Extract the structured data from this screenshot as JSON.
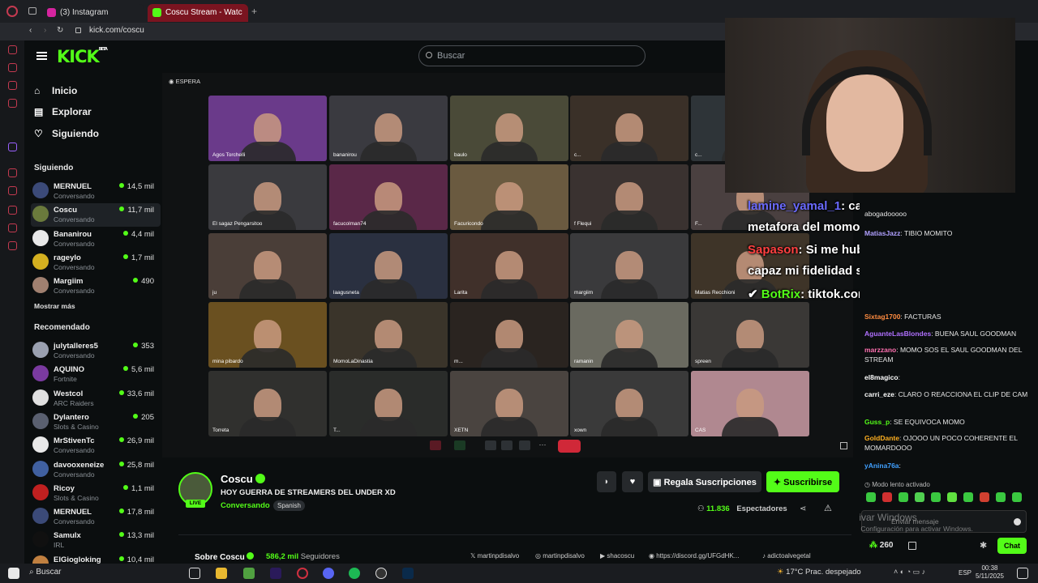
{
  "browser": {
    "tabs": [
      {
        "label": "(3) Instagram",
        "color": "#d6249f"
      },
      {
        "label": "Coscu Stream - Watc",
        "color": "#53fc18"
      }
    ],
    "url": "kick.com/coscu"
  },
  "header": {
    "logo": "KICK",
    "logo_badge": "BETA",
    "search_placeholder": "Buscar"
  },
  "nav": [
    {
      "label": "Inicio",
      "icon": "home-icon"
    },
    {
      "label": "Explorar",
      "icon": "compass-icon"
    },
    {
      "label": "Siguiendo",
      "icon": "heart-icon"
    }
  ],
  "following": {
    "title": "Siguiendo",
    "channels": [
      {
        "name": "MERNUEL",
        "sub": "Conversando",
        "viewers": "14,5 mil",
        "color": "#3b4a78"
      },
      {
        "name": "Coscu",
        "sub": "Conversando",
        "viewers": "11,7 mil",
        "color": "#6a7a3c"
      },
      {
        "name": "Bananirou",
        "sub": "Conversando",
        "viewers": "4,4 mil",
        "color": "#e8e8e8"
      },
      {
        "name": "rageylo",
        "sub": "Conversando",
        "viewers": "1,7 mil",
        "color": "#d4b020"
      },
      {
        "name": "Margiim",
        "sub": "Conversando",
        "viewers": "490",
        "color": "#a08070"
      }
    ],
    "more": "Mostrar más"
  },
  "recommended": {
    "title": "Recomendado",
    "channels": [
      {
        "name": "julytalleres5",
        "sub": "Conversando",
        "viewers": "353",
        "color": "#9aa0b0"
      },
      {
        "name": "AQUINO",
        "sub": "Fortnite",
        "viewers": "5,6 mil",
        "color": "#7a3aa0"
      },
      {
        "name": "Westcol",
        "sub": "ARC Raiders",
        "viewers": "33,6 mil",
        "color": "#e0e0e0"
      },
      {
        "name": "Dylantero",
        "sub": "Slots & Casino",
        "viewers": "205",
        "color": "#5a6070"
      },
      {
        "name": "MrStivenTc",
        "sub": "Conversando",
        "viewers": "26,9 mil",
        "color": "#e8e8e8"
      },
      {
        "name": "davooxeneize",
        "sub": "Conversando",
        "viewers": "25,8 mil",
        "color": "#4060a0"
      },
      {
        "name": "Ricoy",
        "sub": "Slots & Casino",
        "viewers": "1,1 mil",
        "color": "#c02020"
      },
      {
        "name": "MERNUEL",
        "sub": "Conversando",
        "viewers": "17,8 mil",
        "color": "#3b4a78"
      },
      {
        "name": "Samulx",
        "sub": "IRL",
        "viewers": "13,3 mil",
        "color": "#101010"
      },
      {
        "name": "ElGiogloking",
        "sub": "",
        "viewers": "10,4 mil",
        "color": "#c08040"
      }
    ]
  },
  "video": {
    "status": "ESPERA",
    "participants": [
      {
        "name": "Agos Torchelli",
        "color": "#6a3a8a"
      },
      {
        "name": "bananirou",
        "color": "#3a3a40"
      },
      {
        "name": "baulo",
        "color": "#4a4a38"
      },
      {
        "name": "c...",
        "color": "#3a3028"
      },
      {
        "name": "c...",
        "color": "#2e3438"
      },
      {
        "name": "El sagaz Pengarsitoo",
        "color": "#3a3a3e"
      },
      {
        "name": "facucolman74",
        "color": "#5a2848"
      },
      {
        "name": "Facuricondo",
        "color": "#6a5a40"
      },
      {
        "name": "f Flequi",
        "color": "#3a3230"
      },
      {
        "name": "F...",
        "color": "#4a4040"
      },
      {
        "name": "ju",
        "color": "#4a3e38"
      },
      {
        "name": "laagusneta",
        "color": "#2a3040"
      },
      {
        "name": "Larita",
        "color": "#40302a"
      },
      {
        "name": "margiim",
        "color": "#3a3a3c"
      },
      {
        "name": "Matias Recchioni",
        "color": "#3e3428"
      },
      {
        "name": "mina pibardo",
        "color": "#6a5020"
      },
      {
        "name": "MomoLaDinastia",
        "color": "#3a342a"
      },
      {
        "name": "m...",
        "color": "#2a2420"
      },
      {
        "name": "ramanin",
        "color": "#6a6a60"
      },
      {
        "name": "spreen",
        "color": "#3a3836"
      },
      {
        "name": "Torreta",
        "color": "#30302e"
      },
      {
        "name": "T...",
        "color": "#2a2c2a"
      },
      {
        "name": "XETN",
        "color": "#4a4440"
      },
      {
        "name": "xown",
        "color": "#3a3a3a"
      },
      {
        "name": "CAS",
        "color": "#b08890"
      }
    ]
  },
  "overlay_chat": [
    {
      "user": "lamine_yamal_1",
      "text": ": caro bancas la",
      "color": "#6a6aff"
    },
    {
      "user": "",
      "text": "metafora del momo?",
      "color": "#ffffff"
    },
    {
      "user": "Sapason",
      "text": ": Si me hubieras dado el mod",
      "color": "#ff4040"
    },
    {
      "user": "",
      "text": "capaz mi fidelidad seria otra... wink wink",
      "color": "#ffffff"
    },
    {
      "user": "BotRix",
      "text": ": tiktok.com/@_carotala",
      "color": "#53fc18"
    }
  ],
  "chat": {
    "messages": [
      {
        "user": "",
        "text": "abogadooooo",
        "color": "#e6e6e6"
      },
      {
        "user": "MatiasJazz",
        "text": ": TIBIO MOMITO",
        "color": "#b0a0ff"
      },
      {
        "user": "Sixtag1700",
        "text": ": FACTURAS",
        "color": "#ff8c40"
      },
      {
        "user": "AguanteLasBlondes",
        "text": ": BUENA SAUL GOODMAN",
        "color": "#b070ff"
      },
      {
        "user": "marzzano",
        "text": ": MOMO SOS EL SAUL GOODMAN DEL STREAM",
        "color": "#ff70b0"
      },
      {
        "user": "el8magico",
        "text": ":",
        "color": "#ffffff"
      },
      {
        "user": "carri_eze",
        "text": ": CLARO O REACCIONA EL CLIP DE CAM",
        "color": "#ffffff"
      },
      {
        "user": "Guss_p",
        "text": ": SE EQUIVOCA MOMO",
        "color": "#53fc18"
      },
      {
        "user": "GoldDante",
        "text": ": OJOOO UN POCO COHERENTE EL MOMARDOOO",
        "color": "#ffb020"
      },
      {
        "user": "yAnina76a",
        "text": ":",
        "color": "#40a0ff"
      }
    ],
    "slow_mode": "Modo lento activado",
    "input_placeholder": "Enviar mensaje",
    "windows_activate": "Activar Windows",
    "windows_activate_sub": "Ve a Configuración para activar Windows.",
    "points": "260",
    "send_label": "Chat"
  },
  "stream": {
    "name": "Coscu",
    "title": "HOY GUERRA DE STREAMERS DEL UNDER XD",
    "category": "Conversando",
    "tag": "Spanish",
    "live": "LIVE",
    "gift_label": "Regala Suscripciones",
    "subscribe_label": "Suscribirse",
    "viewers": "11.836",
    "viewers_label": "Espectadores",
    "about": "Sobre Coscu",
    "followers": "586,2 mil",
    "followers_label": "Seguidores",
    "socials": [
      "martinpdisalvo",
      "martinpdisalvo",
      "shacoscu",
      "https://discord.gg/UFGdHK...",
      "adictoalvegetal"
    ]
  },
  "taskbar": {
    "search": "Buscar",
    "weather": "17°C",
    "weather_desc": "Prac. despejado",
    "lang": "ESP",
    "time": "00:38",
    "date": "5/11/2025"
  }
}
